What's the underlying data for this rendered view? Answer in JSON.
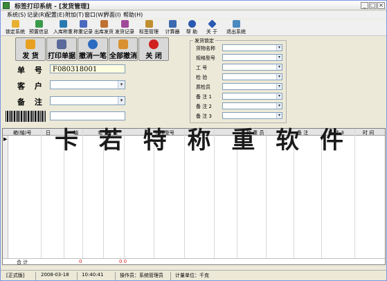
{
  "window": {
    "title": "标签打印系统 - [发货管理]"
  },
  "menu": [
    "系统(S)",
    "记录(R)",
    "配置(E)",
    "附加(T)",
    "窗口(W)",
    "界面(I)",
    "帮助(H)"
  ],
  "toolbar": [
    {
      "label": "锁定系统",
      "icon": "lock-icon",
      "color": "#e8b030"
    },
    {
      "label": "预置信息",
      "icon": "globe-icon",
      "color": "#3a9a4a"
    },
    {
      "label": "入库称重",
      "icon": "import-icon",
      "color": "#2a7ab0"
    },
    {
      "label": "称重记录",
      "icon": "records-icon",
      "color": "#4a6ac0"
    },
    {
      "label": "出库发货",
      "icon": "export-icon",
      "color": "#c07030"
    },
    {
      "label": "发货记录",
      "icon": "ship-records-icon",
      "color": "#a04a9a"
    },
    {
      "label": "标签管理",
      "icon": "tag-icon",
      "color": "#c09030"
    },
    {
      "label": "计算器",
      "icon": "calculator-icon",
      "color": "#3a6ab0"
    },
    {
      "label": "帮 助",
      "icon": "help-icon",
      "color": "#2a5ab0"
    },
    {
      "label": "关 于",
      "icon": "about-icon",
      "color": "#2a5ab0"
    },
    {
      "label": "退出系统",
      "icon": "exit-icon",
      "color": "#4a8ac0"
    }
  ],
  "actions": [
    {
      "label": "发 货",
      "icon": "ship-icon",
      "color": "#e8a020"
    },
    {
      "label": "打印单据",
      "icon": "print-icon",
      "color": "#5a6a9a"
    },
    {
      "label": "撤消一笔",
      "icon": "undo-icon",
      "color": "#2a6ac0"
    },
    {
      "label": "全部撤消",
      "icon": "undo-all-icon",
      "color": "#d89030"
    },
    {
      "label": "关 闭",
      "icon": "close-icon",
      "color": "#d02020"
    }
  ],
  "form": {
    "order_label": "单 号",
    "order_value": "F080318001",
    "customer_label": "客 户",
    "customer_value": "",
    "note_label": "备 注",
    "note_value": ""
  },
  "lock_group": {
    "title": "发货锁定",
    "fields": [
      "货物名称",
      "规格型号",
      "工 号",
      "检 验",
      "质检员",
      "备 注 1",
      "备 注 2",
      "备 注 3"
    ]
  },
  "grid": {
    "columns": [
      "箱(轴)号",
      "日",
      "",
      "毛 重",
      "轴",
      "净 重",
      "规格型号",
      "",
      "称 重 员",
      "",
      "备 注",
      "",
      "备 注 3",
      "时 间"
    ],
    "total_label": "合 计",
    "total_gross": "0",
    "total_net": "0 0"
  },
  "watermark": "卡 若 特 称 重 软 件",
  "status": {
    "version": "[正式版]",
    "date": "2008-03-18",
    "time": "10:40:41",
    "operator": "操作员：系统管理员",
    "unit": "计量单位：千克"
  },
  "colors": {
    "accent": "#7a96df",
    "chrome": "#ece9d8",
    "highlight": "#fffde0"
  }
}
